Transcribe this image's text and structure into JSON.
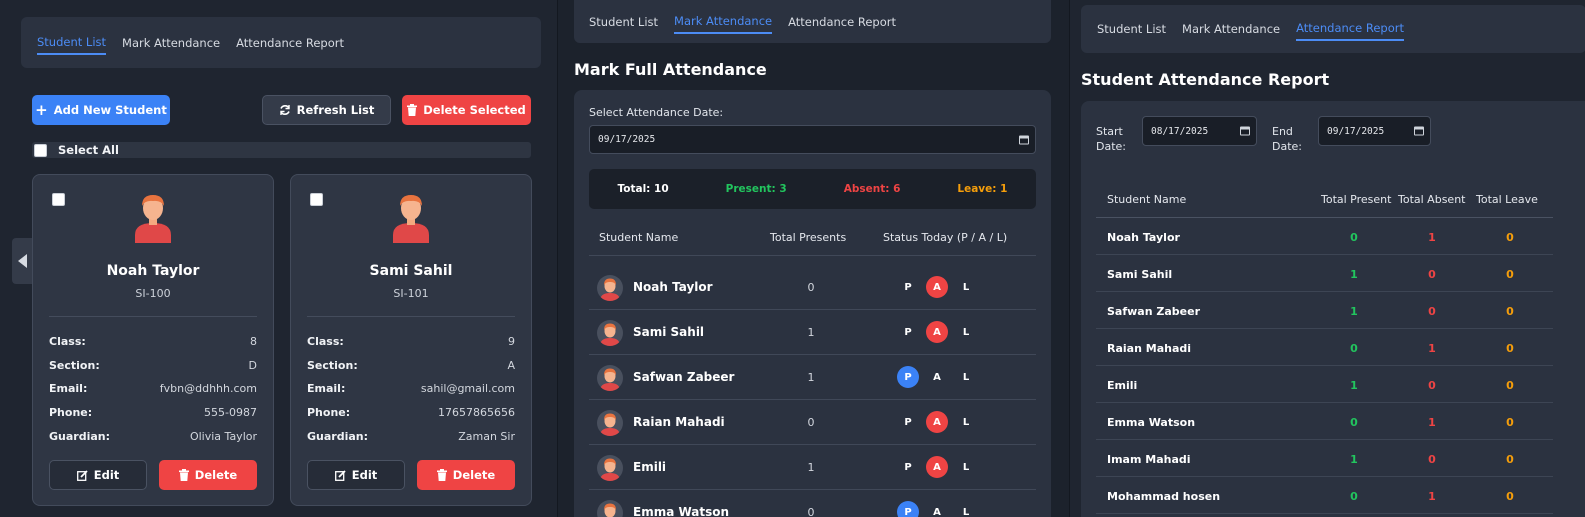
{
  "panel1": {
    "tabs": [
      "Student List",
      "Mark Attendance",
      "Attendance Report"
    ],
    "add_button": "Add New Student",
    "refresh_button": "Refresh List",
    "delete_selected_button": "Delete Selected",
    "select_all_label": "Select All",
    "field_labels": {
      "class": "Class:",
      "section": "Section:",
      "email": "Email:",
      "phone": "Phone:",
      "guardian": "Guardian:"
    },
    "edit_label": "Edit",
    "delete_label": "Delete",
    "students": [
      {
        "name": "Noah Taylor",
        "id": "SI-100",
        "class": "8",
        "section": "D",
        "email": "fvbn@ddhhh.com",
        "phone": "555-0987",
        "guardian": "Olivia Taylor"
      },
      {
        "name": "Sami Sahil",
        "id": "SI-101",
        "class": "9",
        "section": "A",
        "email": "sahil@gmail.com",
        "phone": "17657865656",
        "guardian": "Zaman Sir"
      }
    ]
  },
  "panel2": {
    "tabs": [
      "Student List",
      "Mark Attendance",
      "Attendance Report"
    ],
    "title": "Mark Full Attendance",
    "date_label": "Select Attendance Date:",
    "date_value": "09/17/2025",
    "summary": {
      "total": "Total: 10",
      "present": "Present: 3",
      "absent": "Absent: 6",
      "leave": "Leave: 1"
    },
    "headers": {
      "name": "Student Name",
      "presents": "Total Presents",
      "status": "Status Today (P / A / L)"
    },
    "status_letters": [
      "P",
      "A",
      "L"
    ],
    "rows": [
      {
        "name": "Noah Taylor",
        "presents": "0",
        "status": "A"
      },
      {
        "name": "Sami Sahil",
        "presents": "1",
        "status": "A"
      },
      {
        "name": "Safwan Zabeer",
        "presents": "1",
        "status": "P"
      },
      {
        "name": "Raian Mahadi",
        "presents": "0",
        "status": "A"
      },
      {
        "name": "Emili",
        "presents": "1",
        "status": "A"
      },
      {
        "name": "Emma Watson",
        "presents": "0",
        "status": "P"
      }
    ]
  },
  "panel3": {
    "tabs": [
      "Student List",
      "Mark Attendance",
      "Attendance Report"
    ],
    "title": "Student Attendance Report",
    "start_label": "Start Date:",
    "start_value": "08/17/2025",
    "end_label": "End Date:",
    "end_value": "09/17/2025",
    "headers": {
      "name": "Student Name",
      "present": "Total Present",
      "absent": "Total Absent",
      "leave": "Total Leave"
    },
    "rows": [
      {
        "name": "Noah Taylor",
        "present": "0",
        "absent": "1",
        "leave": "0"
      },
      {
        "name": "Sami Sahil",
        "present": "1",
        "absent": "0",
        "leave": "0"
      },
      {
        "name": "Safwan Zabeer",
        "present": "1",
        "absent": "0",
        "leave": "0"
      },
      {
        "name": "Raian Mahadi",
        "present": "0",
        "absent": "1",
        "leave": "0"
      },
      {
        "name": "Emili",
        "present": "1",
        "absent": "0",
        "leave": "0"
      },
      {
        "name": "Emma Watson",
        "present": "0",
        "absent": "1",
        "leave": "0"
      },
      {
        "name": "Imam Mahadi",
        "present": "1",
        "absent": "0",
        "leave": "0"
      },
      {
        "name": "Mohammad hosen",
        "present": "0",
        "absent": "1",
        "leave": "0"
      }
    ]
  },
  "colors": {
    "accent": "#3b82f6",
    "danger": "#ef4444",
    "success": "#22c55e",
    "warning": "#f59e0b"
  }
}
